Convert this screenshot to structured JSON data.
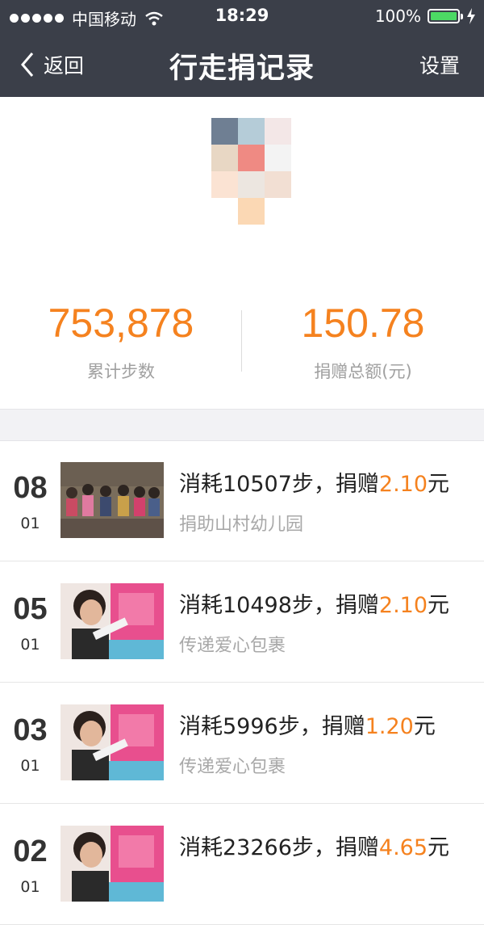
{
  "status_bar": {
    "carrier": "中国移动",
    "time": "18:29",
    "battery": "100%",
    "battery_level": 1.0
  },
  "nav": {
    "back_label": "返回",
    "title": "行走捐记录",
    "settings_label": "设置"
  },
  "stats": {
    "steps_value": "753,878",
    "steps_label": "累计步数",
    "donation_value": "150.78",
    "donation_label": "捐赠总额(元)"
  },
  "records": [
    {
      "day": "08",
      "month": "01",
      "prefix": "消耗10507步，捐赠",
      "amount": "2.10",
      "suffix": "元",
      "project": "捐助山村幼儿园",
      "thumb": "children-photo"
    },
    {
      "day": "05",
      "month": "01",
      "prefix": "消耗10498步，捐赠",
      "amount": "2.10",
      "suffix": "元",
      "project": "传递爱心包裹",
      "thumb": "girl-backpack-photo"
    },
    {
      "day": "03",
      "month": "01",
      "prefix": "消耗5996步，捐赠",
      "amount": "1.20",
      "suffix": "元",
      "project": "传递爱心包裹",
      "thumb": "girl-backpack-photo"
    },
    {
      "day": "02",
      "month": "01",
      "prefix": "消耗23266步，捐赠",
      "amount": "4.65",
      "suffix": "元",
      "project": "",
      "thumb": "girl-backpack-photo"
    }
  ],
  "colors": {
    "nav_bg": "#3b3f49",
    "accent": "#f5821f",
    "battery_green": "#4cd964"
  }
}
